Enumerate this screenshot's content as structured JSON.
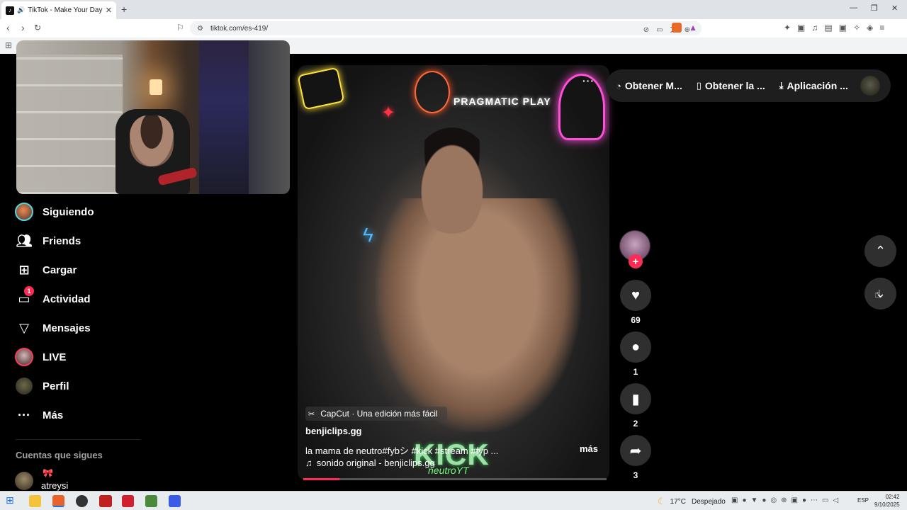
{
  "browser": {
    "tab_title": "TikTok - Make Your Day",
    "url": "tiktok.com/es-419/"
  },
  "sidebar": {
    "items": [
      {
        "label": "Siguiendo"
      },
      {
        "label": "Friends"
      },
      {
        "label": "Cargar"
      },
      {
        "label": "Actividad",
        "badge": "1"
      },
      {
        "label": "Mensajes"
      },
      {
        "label": "LIVE"
      },
      {
        "label": "Perfil"
      },
      {
        "label": "Más"
      }
    ],
    "following_title": "Cuentas que sigues",
    "following": [
      {
        "name": "atreysi",
        "decoration": "🎀"
      }
    ]
  },
  "video": {
    "effect_label": "CapCut · Una edición más fácil",
    "author": "benjiclips.gg",
    "description": "la mama de neutro#fybシ #kick #stream #fyp ...",
    "more_label": "más",
    "sound": "sonido original - benjiclips.gg",
    "progress": 0.12,
    "overlay_text": {
      "brand": "PRAGMATIC PLAY",
      "kick": "KICK",
      "signature": "neutroYT"
    }
  },
  "actions": {
    "likes": "69",
    "comments": "1",
    "saves": "2",
    "shares": "3"
  },
  "top_bar": {
    "items": [
      {
        "label": "Obtener M...",
        "icon": "coin-icon"
      },
      {
        "label": "Obtener la ...",
        "icon": "phone-icon"
      },
      {
        "label": "Aplicación ...",
        "icon": "download-icon"
      }
    ]
  },
  "taskbar": {
    "temperature": "17°C",
    "condition": "Despejado",
    "language": "ESP",
    "time": "02:42",
    "date": "9/10/2025"
  },
  "colors": {
    "accent": "#fe2c55",
    "background": "#000000",
    "button_bg": "#2f2f2f"
  }
}
